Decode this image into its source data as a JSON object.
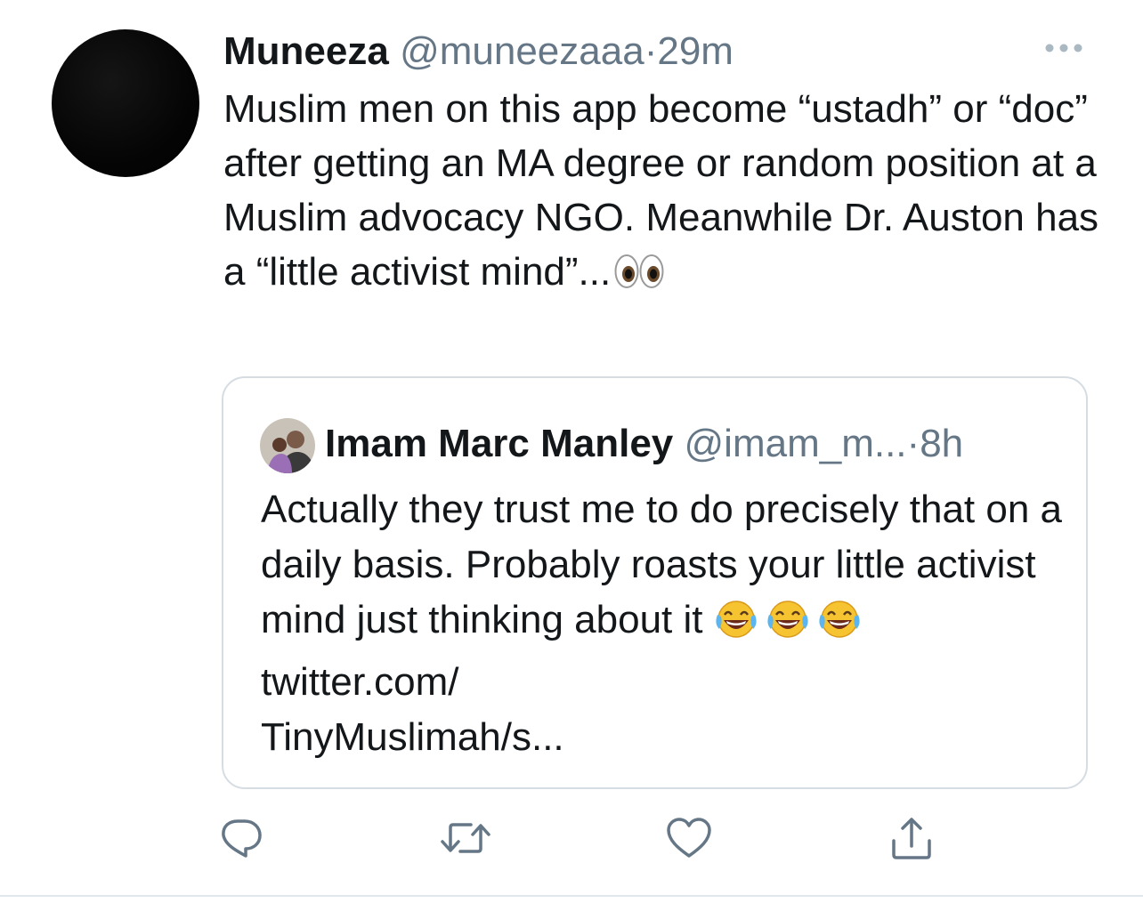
{
  "tweet": {
    "display_name": "Muneeza",
    "handle": "@muneezaaa",
    "separator": "·",
    "time": "29m",
    "text": "Muslim men on this app become “ustadh” or “doc” after getting an MA degree or random position at a Muslim advocacy NGO. Meanwhile Dr. Auston has a “little activist mind”...",
    "emoji": "eyes-emoji",
    "more_icon": "more-dots-icon"
  },
  "quoted": {
    "display_name": "Imam Marc Manley",
    "handle": "@imam_m...",
    "separator": "·",
    "time": "8h",
    "text_before": "Actually they trust me to do precisely that on a daily basis. Probably roasts your little activist mind just thinking about it ",
    "emoji": "face-with-tears-of-joy-emoji",
    "link": "twitter.com/\nTinyMuslimah/s..."
  },
  "actions": [
    {
      "name": "reply",
      "icon": "reply-icon"
    },
    {
      "name": "retweet",
      "icon": "retweet-icon"
    },
    {
      "name": "like",
      "icon": "heart-icon"
    },
    {
      "name": "share",
      "icon": "share-icon"
    }
  ],
  "colors": {
    "text": "#14171a",
    "secondary": "#657786",
    "border": "#d5dce2",
    "icon": "#657786"
  }
}
